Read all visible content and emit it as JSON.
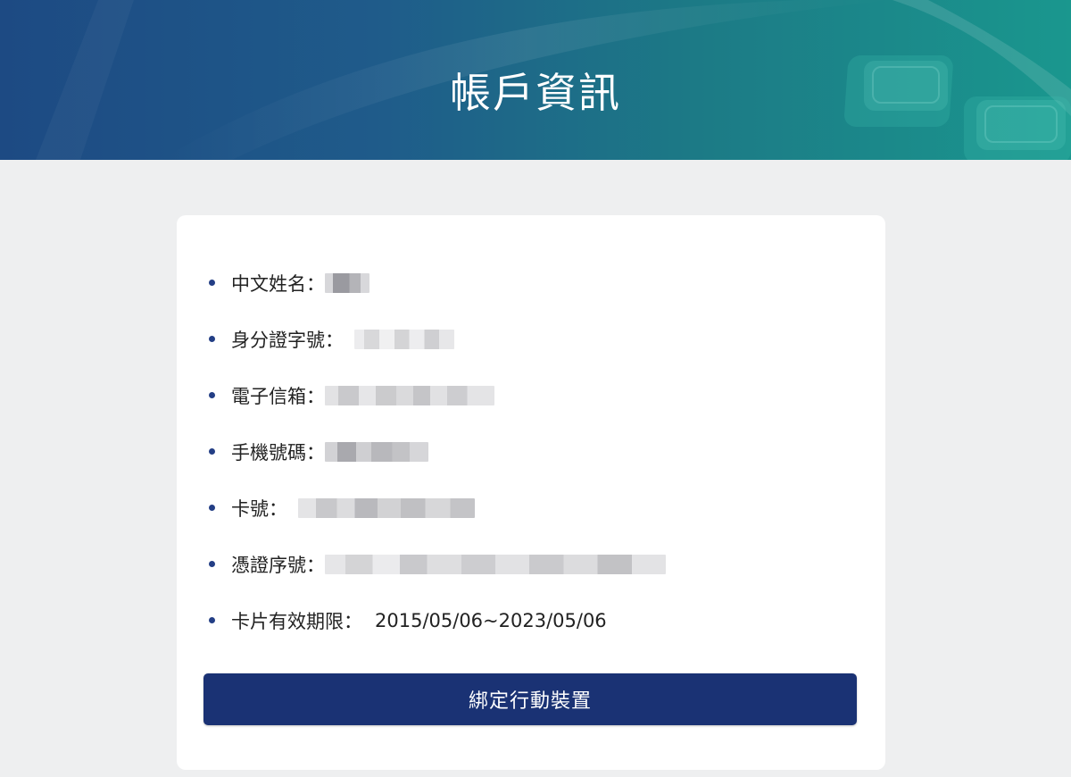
{
  "header": {
    "title": "帳戶資訊"
  },
  "account": {
    "fields": [
      {
        "label": "中文姓名：",
        "value": "",
        "redacted": true
      },
      {
        "label": "身分證字號：",
        "value": "",
        "redacted": true
      },
      {
        "label": "電子信箱：",
        "value": "",
        "redacted": true
      },
      {
        "label": "手機號碼：",
        "value": "",
        "redacted": true
      },
      {
        "label": "卡號：",
        "value": "",
        "redacted": true
      },
      {
        "label": "憑證序號：",
        "value": "",
        "redacted": true
      },
      {
        "label": "卡片有效期限：",
        "value": "2015/05/06~2023/05/06",
        "redacted": false
      }
    ]
  },
  "actions": {
    "bind_device_label": "綁定行動裝置"
  },
  "colors": {
    "header_start": "#1d4a83",
    "header_end": "#1a978e",
    "primary_button": "#1a3274",
    "bullet": "#233e85",
    "page_background": "#eeeff0"
  }
}
